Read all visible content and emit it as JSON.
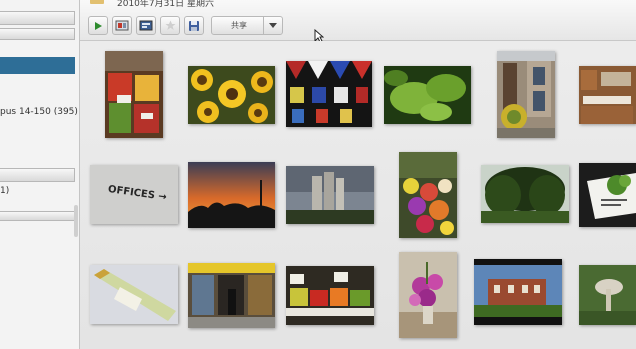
{
  "sidebar": {
    "album_label": "pus 14-150 (395)",
    "count_label": "1)"
  },
  "toolbar": {
    "date_text": "2010年7月31日 星期六",
    "share_label": "共享",
    "buttons": [
      "play-icon",
      "slideshow-icon",
      "photo-info-icon",
      "star-icon",
      "save-icon"
    ]
  },
  "colors": {
    "selection": "#2e6e97",
    "play": "#2e8b2e"
  },
  "photos": [
    {
      "name": "photo-market-fruit",
      "subject": "fruit market stall"
    },
    {
      "name": "photo-sunflowers",
      "subject": "sunflowers"
    },
    {
      "name": "photo-stained-glass",
      "subject": "stained glass window"
    },
    {
      "name": "photo-green-leaves",
      "subject": "green leaves"
    },
    {
      "name": "photo-house-flowers",
      "subject": "house with flower pots"
    },
    {
      "name": "photo-kitchen",
      "subject": "kitchen interior"
    },
    {
      "name": "photo-offices-sign",
      "subject": "offices sign",
      "sign_text": "OFFICES →"
    },
    {
      "name": "photo-sunset",
      "subject": "sunset over trees"
    },
    {
      "name": "photo-apartment-block",
      "subject": "apartment block"
    },
    {
      "name": "photo-flower-stall",
      "subject": "flower stall"
    },
    {
      "name": "photo-willow-tree",
      "subject": "willow tree"
    },
    {
      "name": "photo-green-card",
      "subject": "card with greenery"
    },
    {
      "name": "photo-wine-bottle",
      "subject": "wine bottle"
    },
    {
      "name": "photo-shop-front",
      "subject": "shop front"
    },
    {
      "name": "photo-vegetable-market",
      "subject": "vegetable market"
    },
    {
      "name": "photo-pink-flowers",
      "subject": "pink flowers in vase"
    },
    {
      "name": "photo-brick-house",
      "subject": "brick house"
    },
    {
      "name": "photo-mushroom",
      "subject": "mushroom"
    }
  ]
}
